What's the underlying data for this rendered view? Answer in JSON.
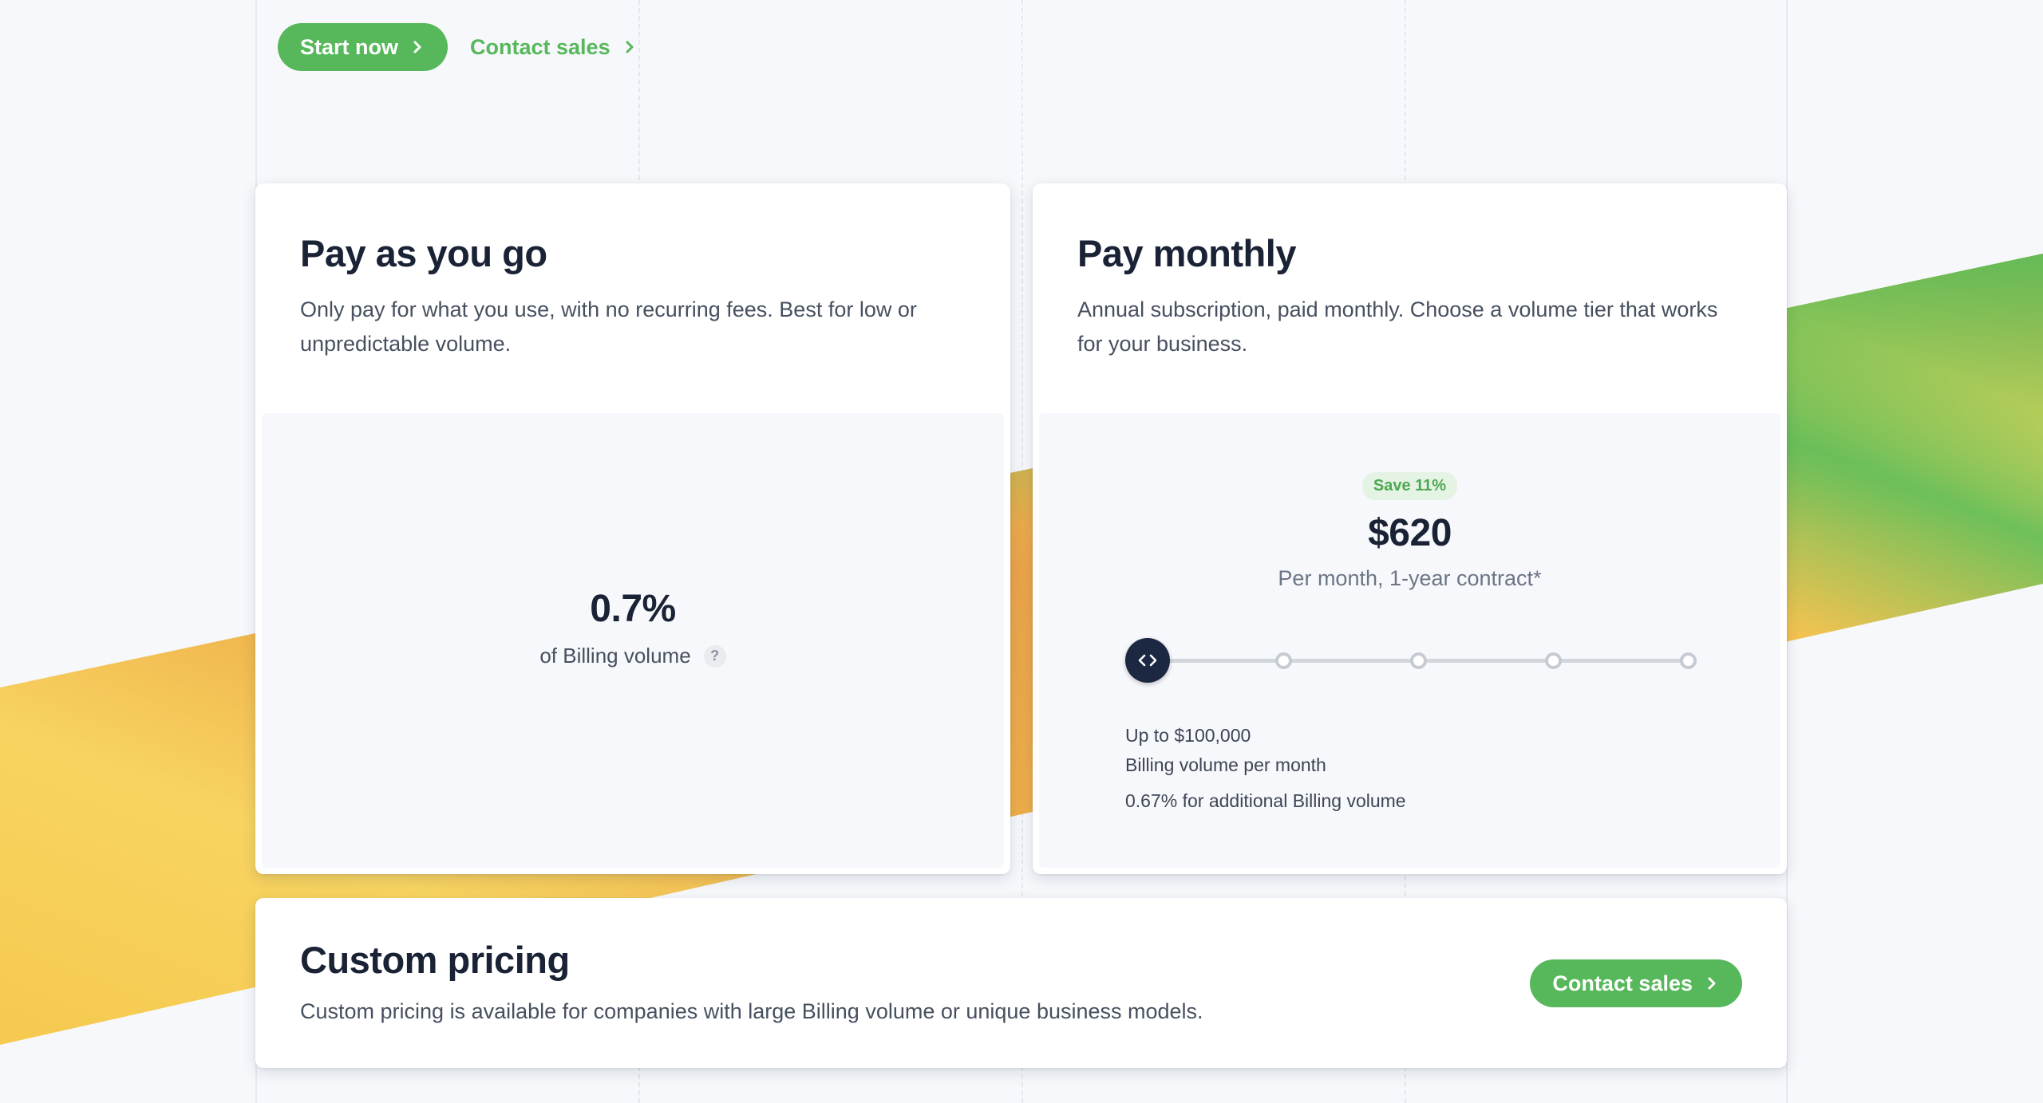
{
  "colors": {
    "accent": "#56b85a",
    "title": "#1a2235",
    "body_text": "#46505f",
    "handle": "#1c2742",
    "badge_bg": "#e5f3e4",
    "page_bg": "#f6f8fb"
  },
  "icons": {
    "chevron": "chevron-right-icon",
    "help": "question-mark-icon",
    "handle": "code-arrows-icon"
  },
  "hero": {
    "start_label": "Start now",
    "contact_label": "Contact sales"
  },
  "payg": {
    "title": "Pay as you go",
    "description": "Only pay for what you use, with no recurring fees. Best for low or unpredictable volume.",
    "rate": "0.7%",
    "rate_label": "of Billing volume",
    "help_symbol": "?"
  },
  "monthly": {
    "title": "Pay monthly",
    "description": "Annual subscription, paid monthly. Choose a volume tier that works for your business.",
    "badge": "Save 11%",
    "price": "$620",
    "price_sub": "Per month, 1-year contract*",
    "slider": {
      "tier_count": 5,
      "selected_tier": 1
    },
    "tier_limit": "Up to $100,000",
    "tier_unit": "Billing volume per month",
    "tier_extra": "0.67% for additional Billing volume"
  },
  "custom": {
    "title": "Custom pricing",
    "description": "Custom pricing is available for companies with large Billing volume or unique business models.",
    "button_label": "Contact sales"
  }
}
